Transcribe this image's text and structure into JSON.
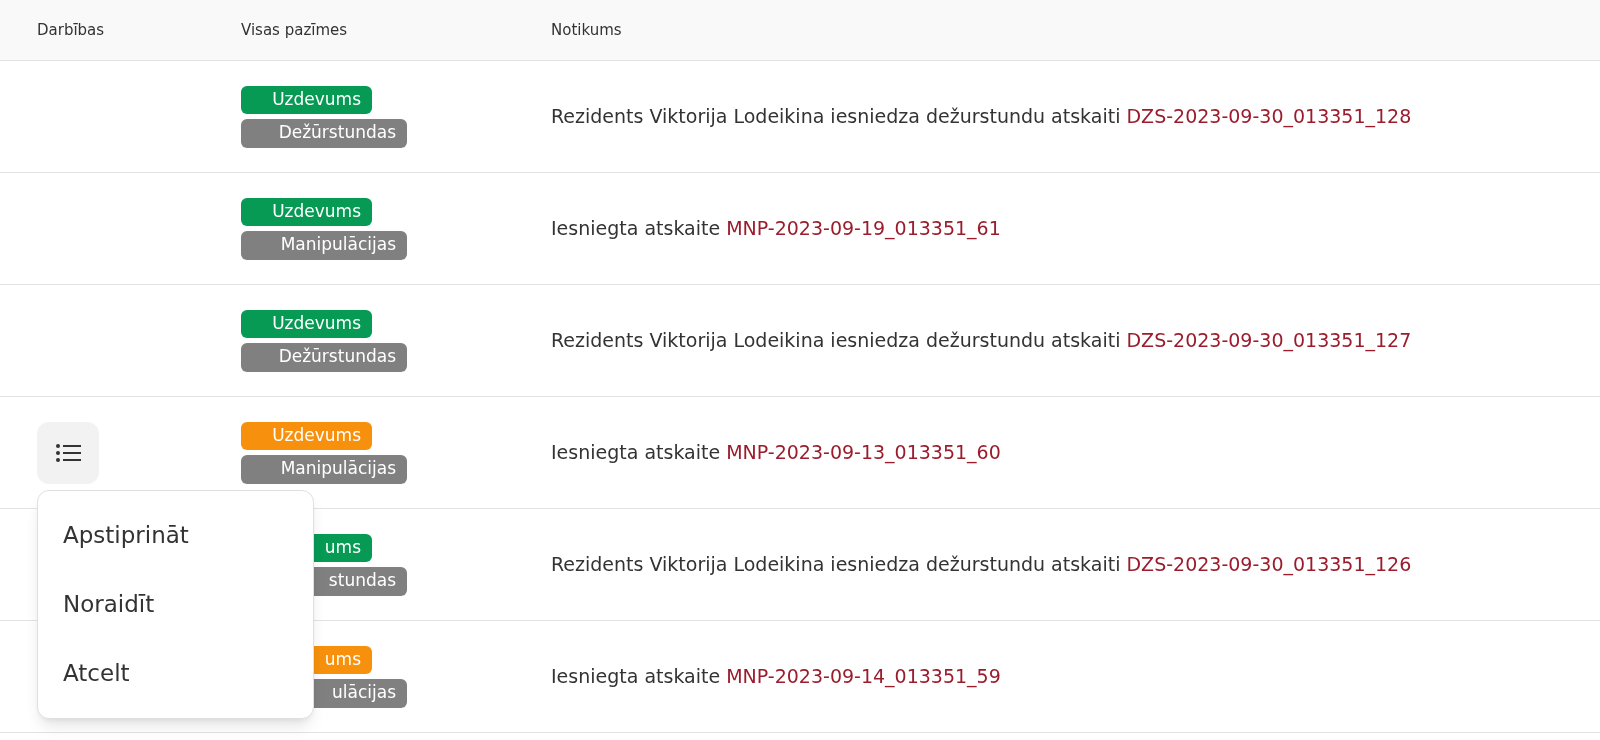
{
  "table": {
    "columns": [
      "Darbības",
      "Visas pazīmes",
      "Notikums"
    ],
    "rows": [
      {
        "status_tag": {
          "label": "Uzdevums",
          "color": "#069a55"
        },
        "category_tag": {
          "label": "Dežūrstundas"
        },
        "event": {
          "text": "Rezidents Viktorija Lodeikina iesniedza dežurstundu atskaiti",
          "link": "DZS-2023-09-30_013351_128"
        }
      },
      {
        "status_tag": {
          "label": "Uzdevums",
          "color": "#069a55"
        },
        "category_tag": {
          "label": "Manipulācijas"
        },
        "event": {
          "text": "Iesniegta atskaite",
          "link": "MNP-2023-09-19_013351_61"
        }
      },
      {
        "status_tag": {
          "label": "Uzdevums",
          "color": "#069a55"
        },
        "category_tag": {
          "label": "Dežūrstundas"
        },
        "event": {
          "text": "Rezidents Viktorija Lodeikina iesniedza dežurstundu atskaiti",
          "link": "DZS-2023-09-30_013351_127"
        }
      },
      {
        "actions": {
          "expanded": true,
          "items": [
            "Apstiprināt",
            "Noraidīt",
            "Atcelt"
          ]
        },
        "status_tag": {
          "label": "Uzdevums",
          "color": "#f7910d"
        },
        "category_tag": {
          "label": "Manipulācijas"
        },
        "event": {
          "text": "Iesniegta atskaite",
          "link": "MNP-2023-09-13_013351_60"
        }
      },
      {
        "status_tag": {
          "label": "ums",
          "color": "#069a55"
        },
        "category_tag": {
          "label": "stundas"
        },
        "event": {
          "text": "Rezidents Viktorija Lodeikina iesniedza dežurstundu atskaiti",
          "link": "DZS-2023-09-30_013351_126"
        }
      },
      {
        "status_tag": {
          "label": "ums",
          "color": "#f7910d"
        },
        "category_tag": {
          "label": "ulācijas"
        },
        "event": {
          "text": "Iesniegta atskaite",
          "link": "MNP-2023-09-14_013351_59"
        }
      }
    ]
  }
}
